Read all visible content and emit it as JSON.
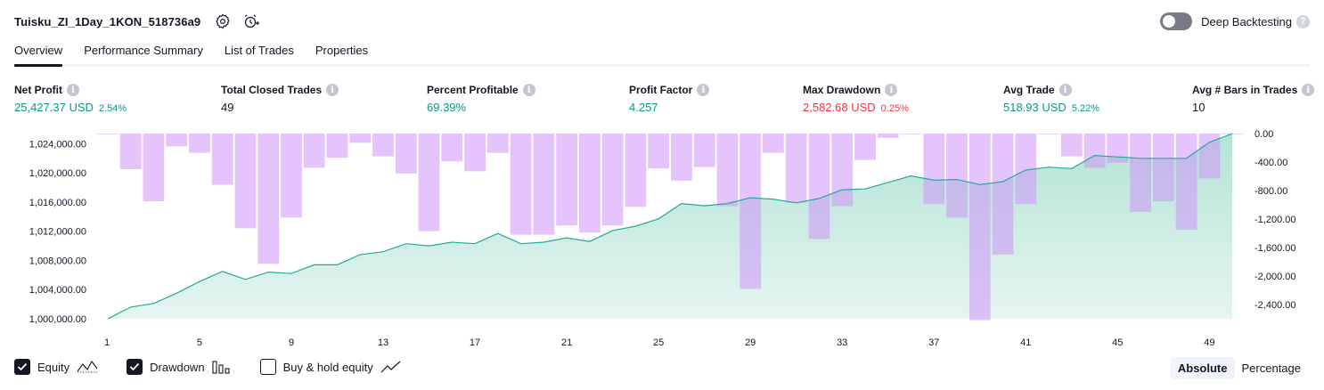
{
  "header": {
    "strategy_name": "Tuisku_ZI_1Day_1KON_518736a9",
    "deep_backtesting_label": "Deep Backtesting",
    "deep_backtesting_enabled": false
  },
  "tabs": [
    {
      "label": "Overview",
      "active": true
    },
    {
      "label": "Performance Summary",
      "active": false
    },
    {
      "label": "List of Trades",
      "active": false
    },
    {
      "label": "Properties",
      "active": false
    }
  ],
  "metrics": {
    "net_profit": {
      "label": "Net Profit",
      "value": "25,427.37 USD",
      "pct": "2.54%"
    },
    "total_closed_trades": {
      "label": "Total Closed Trades",
      "value": "49"
    },
    "percent_profitable": {
      "label": "Percent Profitable",
      "value": "69.39%"
    },
    "profit_factor": {
      "label": "Profit Factor",
      "value": "4.257"
    },
    "max_drawdown": {
      "label": "Max Drawdown",
      "value": "2,582.68 USD",
      "pct": "0.25%"
    },
    "avg_trade": {
      "label": "Avg Trade",
      "value": "518.93 USD",
      "pct": "5.22%"
    },
    "avg_bars": {
      "label": "Avg # Bars in Trades",
      "value": "10"
    }
  },
  "colors": {
    "positive": "#089981",
    "negative": "#f23645",
    "equity_line": "#22ab94",
    "equity_fill": "#c8ebe2",
    "drawdown_bar": "#ce93f8"
  },
  "chart_data": {
    "type": "bar",
    "x": [
      1,
      2,
      3,
      4,
      5,
      6,
      7,
      8,
      9,
      10,
      11,
      12,
      13,
      14,
      15,
      16,
      17,
      18,
      19,
      20,
      21,
      22,
      23,
      24,
      25,
      26,
      27,
      28,
      29,
      30,
      31,
      32,
      33,
      34,
      35,
      36,
      37,
      38,
      39,
      40,
      41,
      42,
      43,
      44,
      45,
      46,
      47,
      48,
      49,
      50
    ],
    "x_ticks": [
      1,
      5,
      9,
      13,
      17,
      21,
      25,
      29,
      33,
      37,
      41,
      45,
      49
    ],
    "equity_axis": {
      "ticks": [
        "1,000,000.00",
        "1,004,000.00",
        "1,008,000.00",
        "1,012,000.00",
        "1,016,000.00",
        "1,020,000.00",
        "1,024,000.00"
      ],
      "ylim": [
        1000000,
        1025400
      ]
    },
    "drawdown_axis": {
      "ticks": [
        "0.00",
        "-400.00",
        "-800.00",
        "-1,200.00",
        "-1,600.00",
        "-2,000.00",
        "-2,400.00"
      ],
      "ylim": [
        -2600,
        0
      ]
    },
    "series": [
      {
        "name": "Equity",
        "values": [
          1000000,
          1001600,
          1002100,
          1003500,
          1005100,
          1006500,
          1005400,
          1006400,
          1006200,
          1007400,
          1007400,
          1008800,
          1009200,
          1010300,
          1010000,
          1010500,
          1010300,
          1011700,
          1010300,
          1010500,
          1011100,
          1010600,
          1012100,
          1012700,
          1013700,
          1015800,
          1015500,
          1015800,
          1016600,
          1016400,
          1015900,
          1016500,
          1017700,
          1017800,
          1018700,
          1019600,
          1019000,
          1019100,
          1018400,
          1018800,
          1020400,
          1020800,
          1020600,
          1022400,
          1022200,
          1022000,
          1022000,
          1022000,
          1024200,
          1025400
        ]
      },
      {
        "name": "Drawdown",
        "values": [
          0,
          -500,
          -950,
          -180,
          -270,
          -720,
          -1330,
          -1830,
          -1180,
          -480,
          -340,
          -130,
          -320,
          -560,
          -1370,
          -390,
          -530,
          -270,
          -1420,
          -1420,
          -1290,
          -1390,
          -1290,
          -1030,
          -490,
          -660,
          -470,
          -1020,
          -2180,
          -270,
          -970,
          -1480,
          -1020,
          -370,
          -60,
          0,
          -990,
          -1180,
          -2620,
          -1700,
          -990,
          0,
          -320,
          -480,
          -410,
          -1100,
          -950,
          -1350,
          -630,
          0
        ]
      }
    ]
  },
  "legend": {
    "equity": {
      "label": "Equity",
      "checked": true
    },
    "drawdown": {
      "label": "Drawdown",
      "checked": true
    },
    "buy_hold": {
      "label": "Buy & hold equity",
      "checked": false
    }
  },
  "view_mode": {
    "absolute_label": "Absolute",
    "percentage_label": "Percentage",
    "active": "absolute"
  }
}
